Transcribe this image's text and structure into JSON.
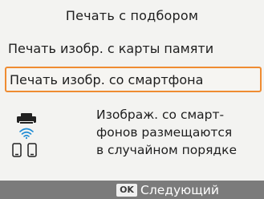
{
  "header": {
    "title": "Печать с подбором"
  },
  "menu": {
    "items": [
      {
        "label": "Печать изобр. с карты памяти",
        "selected": false
      },
      {
        "label": "Печать изобр. со смартфона",
        "selected": true
      }
    ]
  },
  "description": {
    "text": "Изображ. со смарт-\nфонов размещаются\nв случайном порядке",
    "icons": [
      "printer-icon",
      "wifi-icon",
      "smartphones-icon"
    ]
  },
  "footer": {
    "ok_key": "OK",
    "next_label": "Следующий"
  },
  "colors": {
    "background": "#f3f3f1",
    "selection_border": "#ef8c32",
    "footer_bar": "#7b7b7b",
    "wifi_accent": "#1e8bd4"
  }
}
